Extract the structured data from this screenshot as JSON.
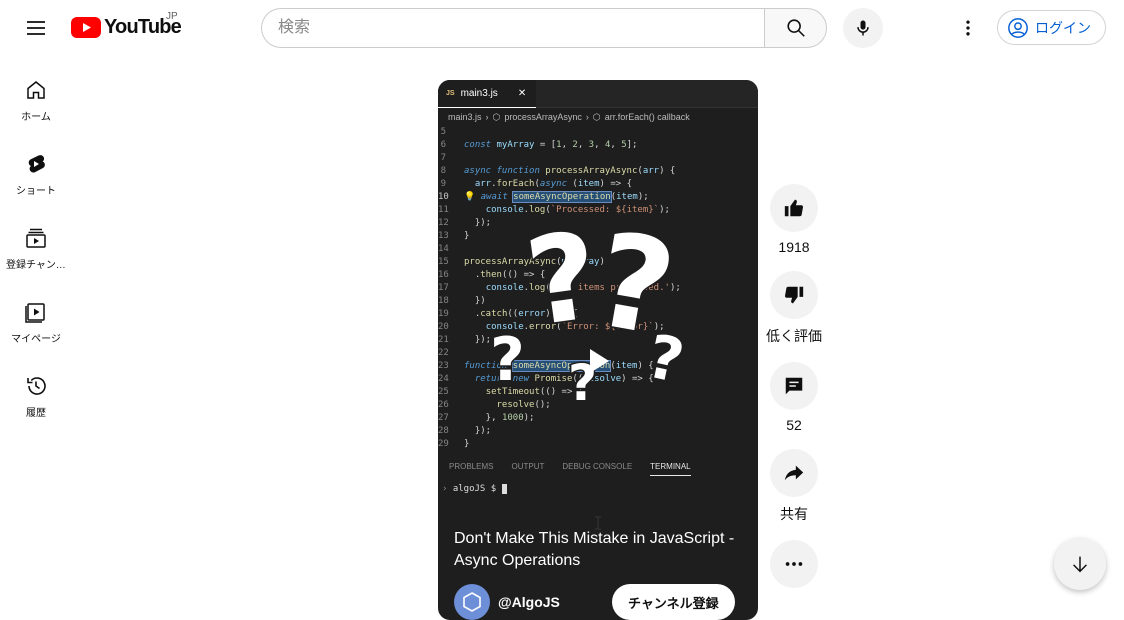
{
  "header": {
    "logo_text": "YouTube",
    "region": "JP",
    "search_placeholder": "検索",
    "login_label": "ログイン"
  },
  "sidebar": {
    "items": [
      {
        "label": "ホーム",
        "icon": "home-icon"
      },
      {
        "label": "ショート",
        "icon": "shorts-icon"
      },
      {
        "label": "登録チャンネル",
        "icon": "subscriptions-icon"
      },
      {
        "label": "マイページ",
        "icon": "you-icon"
      },
      {
        "label": "履歴",
        "icon": "history-icon"
      }
    ]
  },
  "short": {
    "code_tab": "main3.js",
    "code_tab_badge": "JS",
    "breadcrumb": [
      "main3.js",
      "processArrayAsync",
      "arr.forEach() callback"
    ],
    "panel_tabs": [
      "PROBLEMS",
      "OUTPUT",
      "DEBUG CONSOLE",
      "TERMINAL"
    ],
    "terminal_prompt": "algoJS $",
    "title": "Don't Make This Mistake in JavaScript - Async Operations",
    "channel_name": "@AlgoJS",
    "subscribe_label": "チャンネル登録"
  },
  "actions": {
    "like_count": "1918",
    "dislike_label": "低く評価",
    "comment_count": "52",
    "share_label": "共有"
  },
  "colors": {
    "brand_red": "#ff0000",
    "link_blue": "#065fd4",
    "button_gray": "#f2f2f2"
  }
}
